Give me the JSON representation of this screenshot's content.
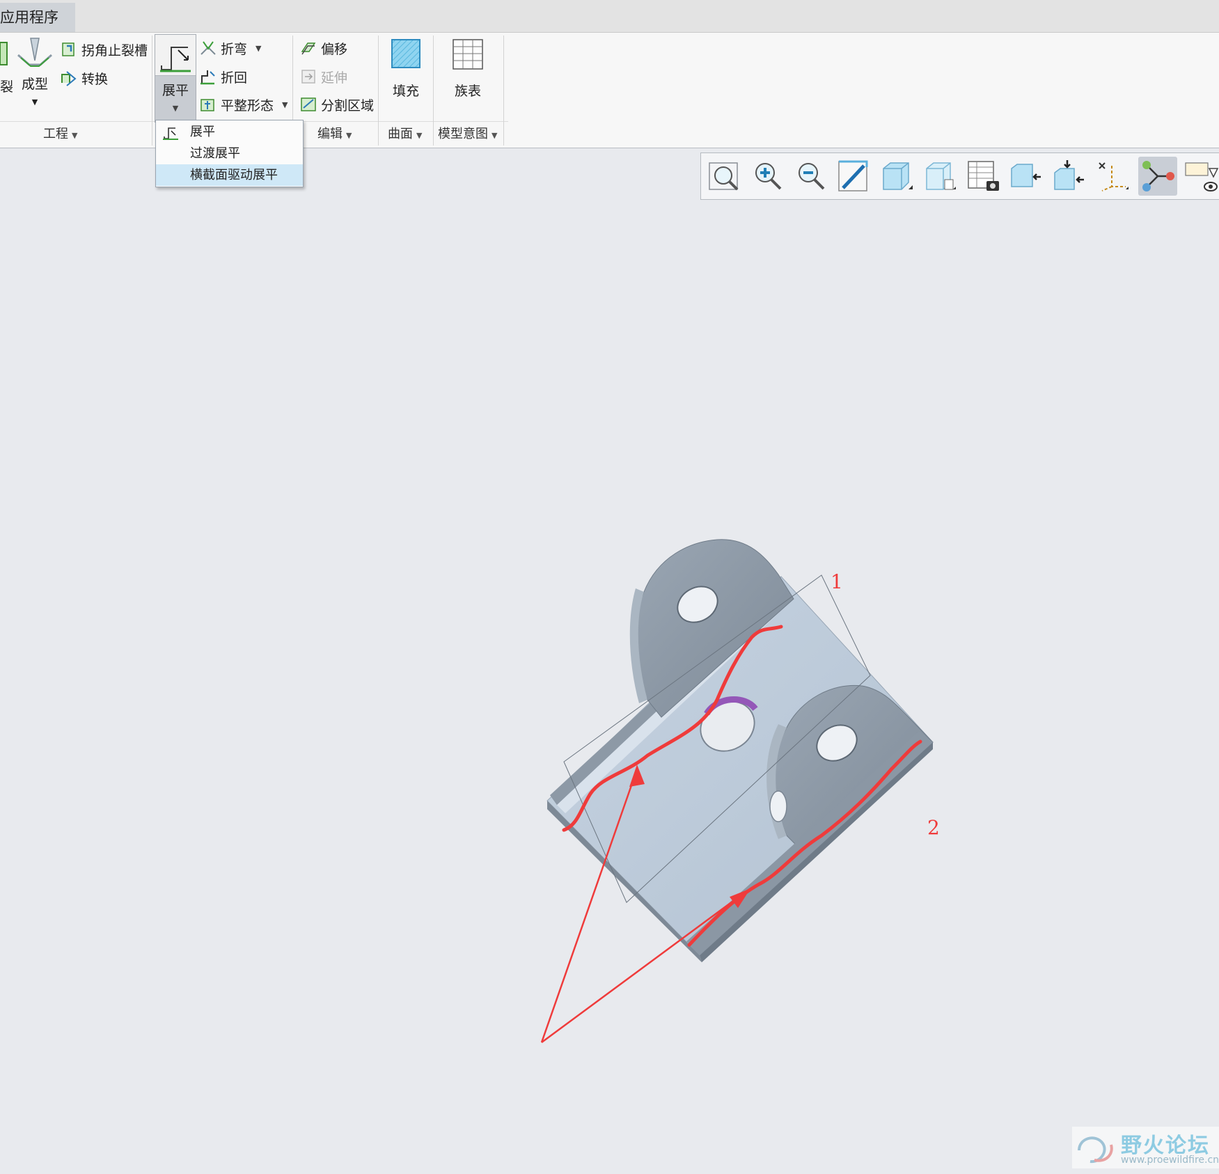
{
  "tabs": {
    "apps": "应用程序"
  },
  "ribbon": {
    "cut_partial": "裂",
    "form": "成型",
    "corner_relief": "拐角止裂槽",
    "convert": "转换",
    "flatten": "展平",
    "bend": "折弯",
    "bend_back": "折回",
    "flat_state": "平整形态",
    "offset": "偏移",
    "extend": "延伸",
    "split_area": "分割区域",
    "fill": "填充",
    "family_table": "族表"
  },
  "groups": {
    "engineering": "工程",
    "editing": "编辑",
    "surface": "曲面",
    "model_intent": "模型意图"
  },
  "flatten_menu": {
    "items": [
      {
        "label": "展平"
      },
      {
        "label": "过渡展平"
      },
      {
        "label": "横截面驱动展平"
      }
    ]
  },
  "view_toolbar": {
    "icons": [
      "refit-icon",
      "zoom-in-icon",
      "zoom-out-icon",
      "repaint-icon",
      "display-style-icon",
      "saved-orientations-icon",
      "view-manager-icon",
      "section-icon",
      "annotation-display-icon",
      "datum-display-icon",
      "spin-center-icon",
      "appearance-icon"
    ]
  },
  "annotations": {
    "label_1": "1",
    "label_2": "2",
    "annotation_color": "#ef3b3b"
  },
  "watermark": {
    "title": "野火论坛",
    "url": "www.proewildfire.cn"
  }
}
